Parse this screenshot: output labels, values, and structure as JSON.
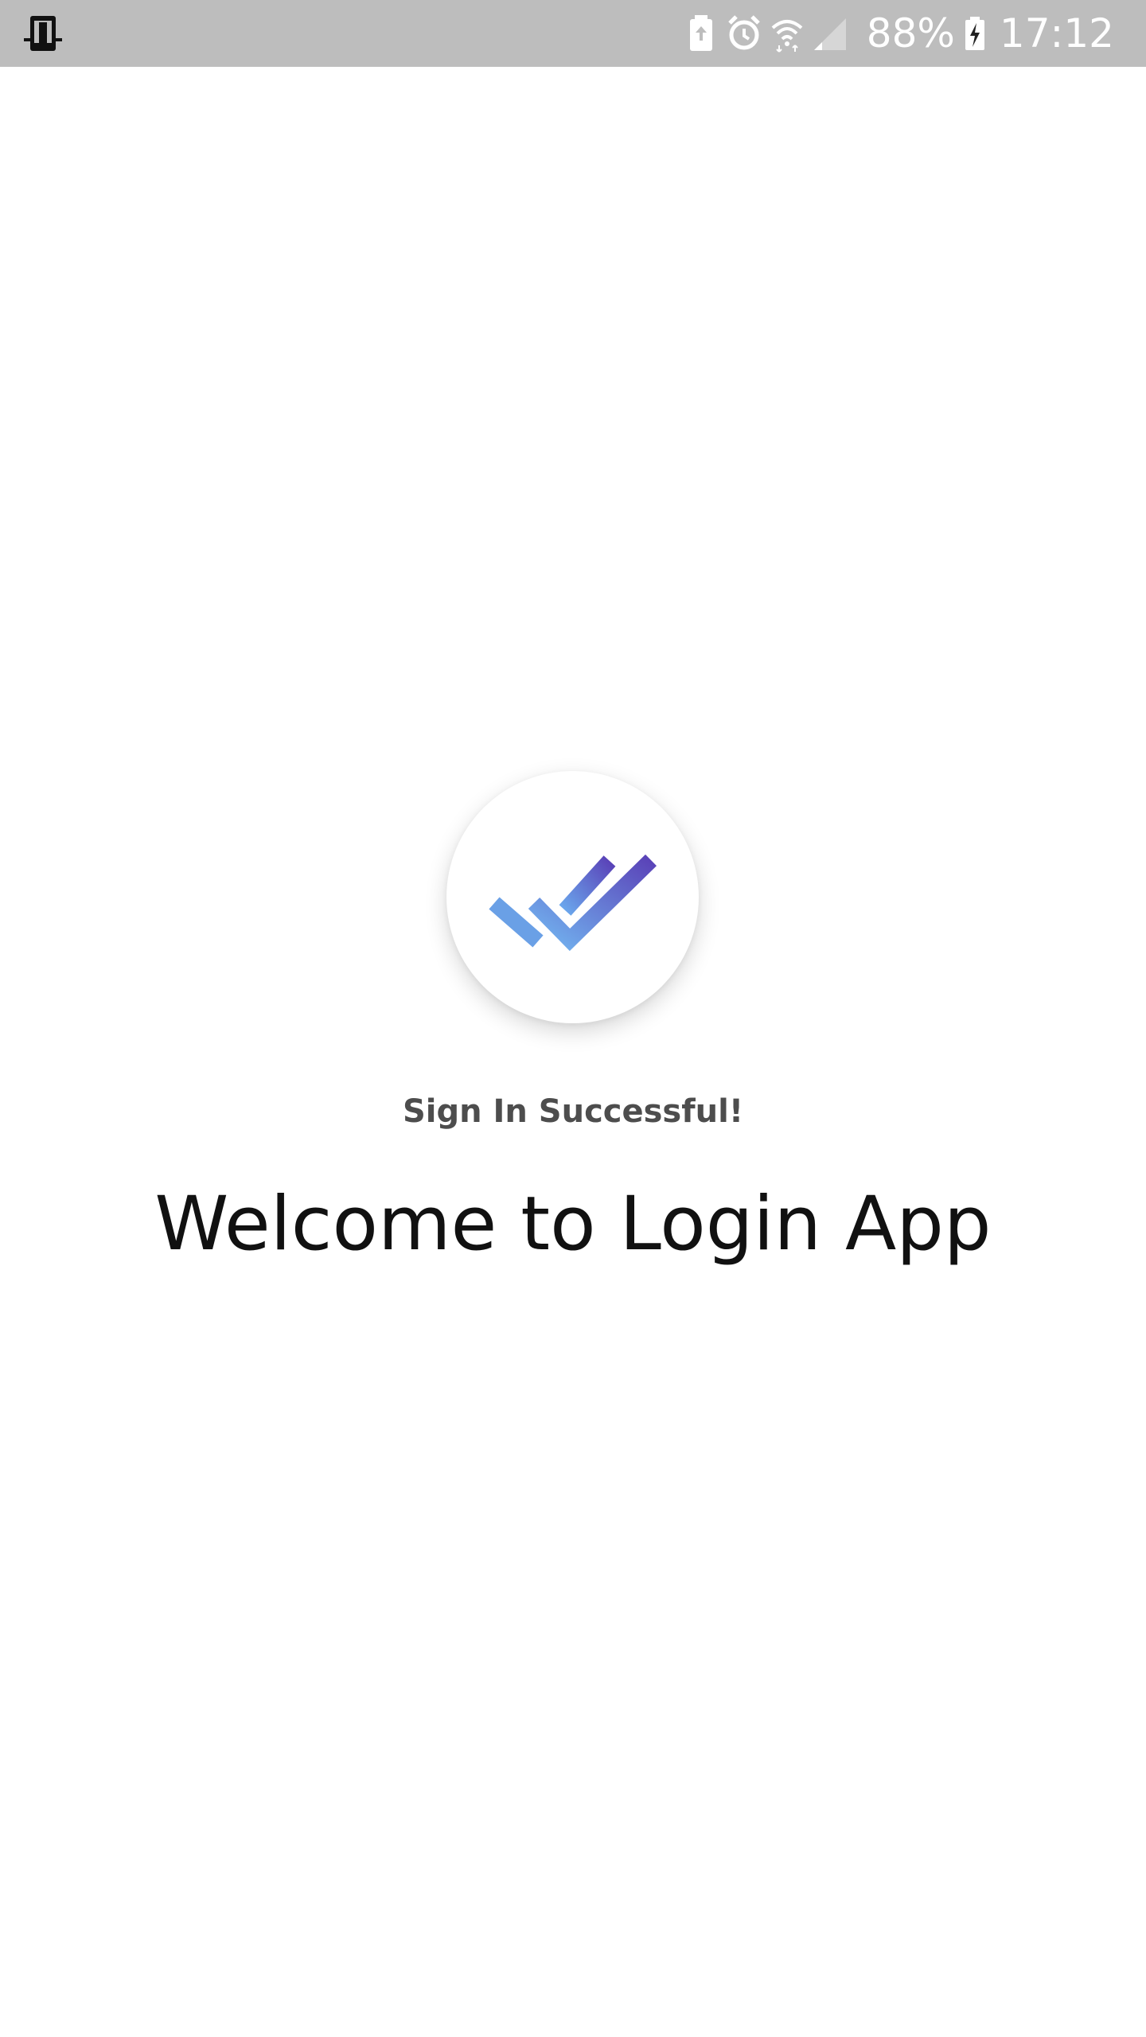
{
  "status_bar": {
    "left_icon": "device-transfer-icon",
    "icons": [
      "battery-saver-icon",
      "alarm-icon",
      "wifi-icon",
      "cell-signal-icon"
    ],
    "battery_percent": "88%",
    "charging_icon": "battery-charging-icon",
    "time": "17:12",
    "background_color": "#bdbdbd"
  },
  "main": {
    "check_icon": "double-check-icon",
    "subtitle": "Sign In Successful!",
    "title": "Welcome to Login App",
    "accent_colors": [
      "#6aa6ec",
      "#5a43b8"
    ]
  }
}
